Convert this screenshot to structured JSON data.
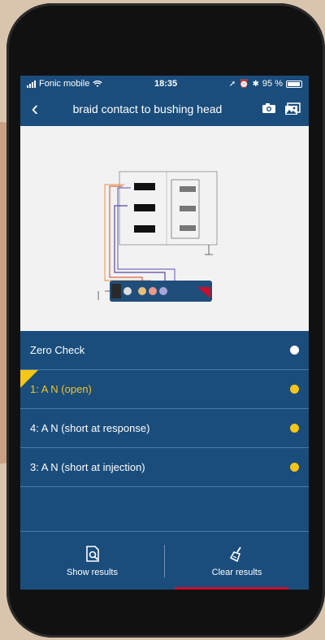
{
  "status_bar": {
    "carrier": "Fonic mobile",
    "time": "18:35",
    "battery": "95 %"
  },
  "nav": {
    "title": "braid contact to bushing head",
    "icons": [
      "camera-icon",
      "gallery-icon"
    ]
  },
  "list": {
    "items": [
      {
        "label": "Zero Check",
        "active": false,
        "dot_color": "#ffffff"
      },
      {
        "label": "1: A N (open)",
        "active": true,
        "dot_color": "#f5c518"
      },
      {
        "label": "4: A N (short at response)",
        "active": false,
        "dot_color": "#f5c518"
      },
      {
        "label": "3: A N (short at injection)",
        "active": false,
        "dot_color": "#f5c518"
      }
    ]
  },
  "tabbar": {
    "show_results": "Show results",
    "clear_results": "Clear results"
  },
  "colors": {
    "primary": "#1a4d7c",
    "accent": "#f5c518",
    "divider": "#4a7ba3",
    "brand_red": "#c8102e"
  }
}
